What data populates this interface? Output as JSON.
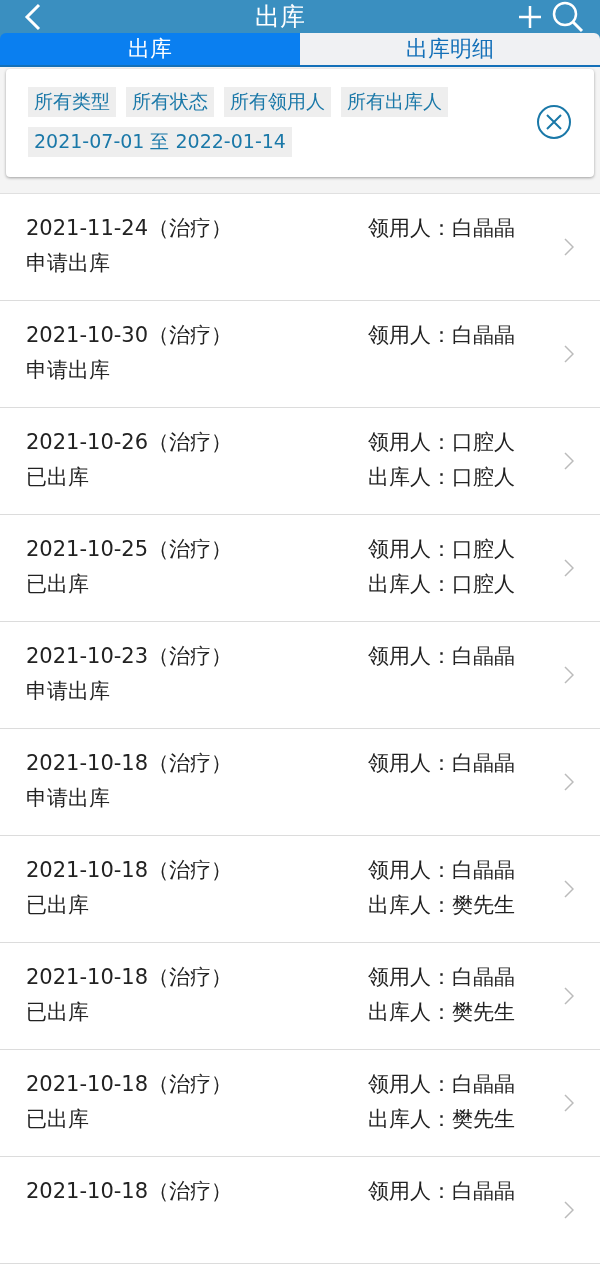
{
  "header": {
    "title": "出库"
  },
  "tabs": [
    {
      "label": "出库",
      "selected": true
    },
    {
      "label": "出库明细",
      "selected": false
    }
  ],
  "filters": {
    "chips": [
      "所有类型",
      "所有状态",
      "所有领用人",
      "所有出库人",
      "2021-07-01 至 2022-01-14"
    ]
  },
  "records": [
    {
      "title": "2021-11-24（治疗）",
      "status": "申请出库",
      "recipient": "领用人：白晶晶"
    },
    {
      "title": "2021-10-30（治疗）",
      "status": "申请出库",
      "recipient": "领用人：白晶晶"
    },
    {
      "title": "2021-10-26（治疗）",
      "status": "已出库",
      "recipient": "领用人：口腔人",
      "issuer": "出库人：口腔人"
    },
    {
      "title": "2021-10-25（治疗）",
      "status": "已出库",
      "recipient": "领用人：口腔人",
      "issuer": "出库人：口腔人"
    },
    {
      "title": "2021-10-23（治疗）",
      "status": "申请出库",
      "recipient": "领用人：白晶晶"
    },
    {
      "title": "2021-10-18（治疗）",
      "status": "申请出库",
      "recipient": "领用人：白晶晶"
    },
    {
      "title": "2021-10-18（治疗）",
      "status": "已出库",
      "recipient": "领用人：白晶晶",
      "issuer": "出库人：樊先生"
    },
    {
      "title": "2021-10-18（治疗）",
      "status": "已出库",
      "recipient": "领用人：白晶晶",
      "issuer": "出库人：樊先生"
    },
    {
      "title": "2021-10-18（治疗）",
      "status": "已出库",
      "recipient": "领用人：白晶晶",
      "issuer": "出库人：樊先生"
    },
    {
      "title": "2021-10-18（治疗）",
      "recipient": "领用人：白晶晶"
    }
  ]
}
